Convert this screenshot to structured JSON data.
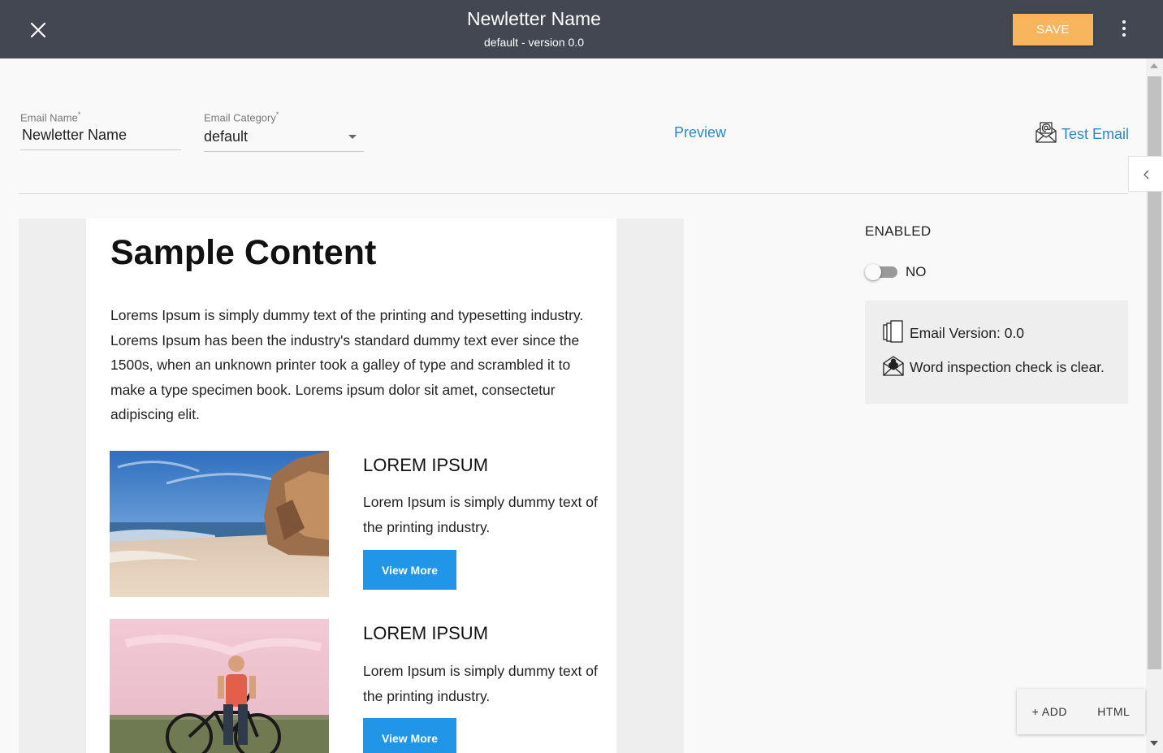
{
  "header": {
    "title": "Newletter Name",
    "subtitle": "default - version 0.0",
    "save_label": "SAVE",
    "close_icon": "close-icon",
    "more_icon": "more-vert-icon",
    "save_color": "#f7b55e",
    "bar_color": "#424752"
  },
  "form": {
    "email_name": {
      "label": "Email Name",
      "required": "*",
      "value": "Newletter Name"
    },
    "email_category": {
      "label": "Email Category",
      "required": "*",
      "value": "default"
    },
    "preview_label": "Preview",
    "test_email_label": "Test Email",
    "link_color": "#2d87d0"
  },
  "email": {
    "heading": "Sample Content",
    "paragraph": "Lorems Ipsum is simply dummy text of the printing and typesetting industry. Lorems Ipsum has been the industry's standard dummy text ever since the 1500s, when an unknown printer took a galley of type and scrambled it to make a type specimen book. Lorems ipsum dolor sit amet, consectetur adipiscing elit.",
    "cards": [
      {
        "title": "LOREM IPSUM",
        "text": "Lorem Ipsum is simply dummy text of the printing industry.",
        "button": "View More",
        "image": "beach-photo"
      },
      {
        "title": "LOREM IPSUM",
        "text": "Lorem Ipsum is simply dummy text of the printing industry.",
        "button": "View More",
        "image": "cyclist-photo"
      }
    ],
    "button_color": "#2196e8"
  },
  "settings": {
    "enabled_label": "ENABLED",
    "toggle_state": "NO",
    "email_version": "Email Version: 0.0",
    "inspection_status": "Word inspection check is clear."
  },
  "actions": {
    "add_label": "+ ADD",
    "html_label": "HTML"
  }
}
